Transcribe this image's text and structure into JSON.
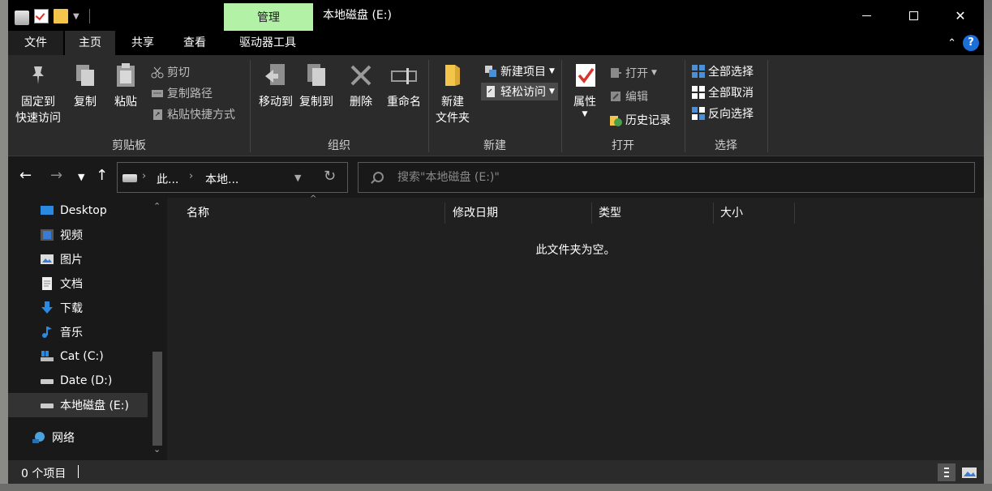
{
  "title_bar": {
    "manage_tab": "管理",
    "window_title": "本地磁盘 (E:)"
  },
  "ribbon_tabs": [
    "文件",
    "主页",
    "共享",
    "查看",
    "驱动器工具"
  ],
  "ribbon": {
    "clipboard": {
      "label": "剪贴板",
      "pin": [
        "固定到",
        "快速访问"
      ],
      "copy": "复制",
      "paste": "粘贴",
      "cut": "剪切",
      "copy_path": "复制路径",
      "paste_shortcut": "粘贴快捷方式"
    },
    "organize": {
      "label": "组织",
      "move_to": "移动到",
      "copy_to": "复制到",
      "delete": "删除",
      "rename": "重命名"
    },
    "new": {
      "label": "新建",
      "new_folder": [
        "新建",
        "文件夹"
      ],
      "new_item": "新建项目",
      "easy_access": "轻松访问"
    },
    "open": {
      "label": "打开",
      "properties": "属性",
      "open": "打开",
      "edit": "编辑",
      "history": "历史记录"
    },
    "select": {
      "label": "选择",
      "select_all": "全部选择",
      "select_none": "全部取消",
      "invert": "反向选择"
    }
  },
  "address": {
    "seg1": "此...",
    "seg2": "本地..."
  },
  "search": {
    "placeholder": "搜索\"本地磁盘 (E:)\""
  },
  "nav_items": [
    "Desktop",
    "视频",
    "图片",
    "文档",
    "下载",
    "音乐",
    "Cat (C:)",
    "Date (D:)",
    "本地磁盘 (E:)",
    "网络"
  ],
  "columns": [
    "名称",
    "修改日期",
    "类型",
    "大小"
  ],
  "empty_message": "此文件夹为空。",
  "status": {
    "count": "0 个项目"
  }
}
